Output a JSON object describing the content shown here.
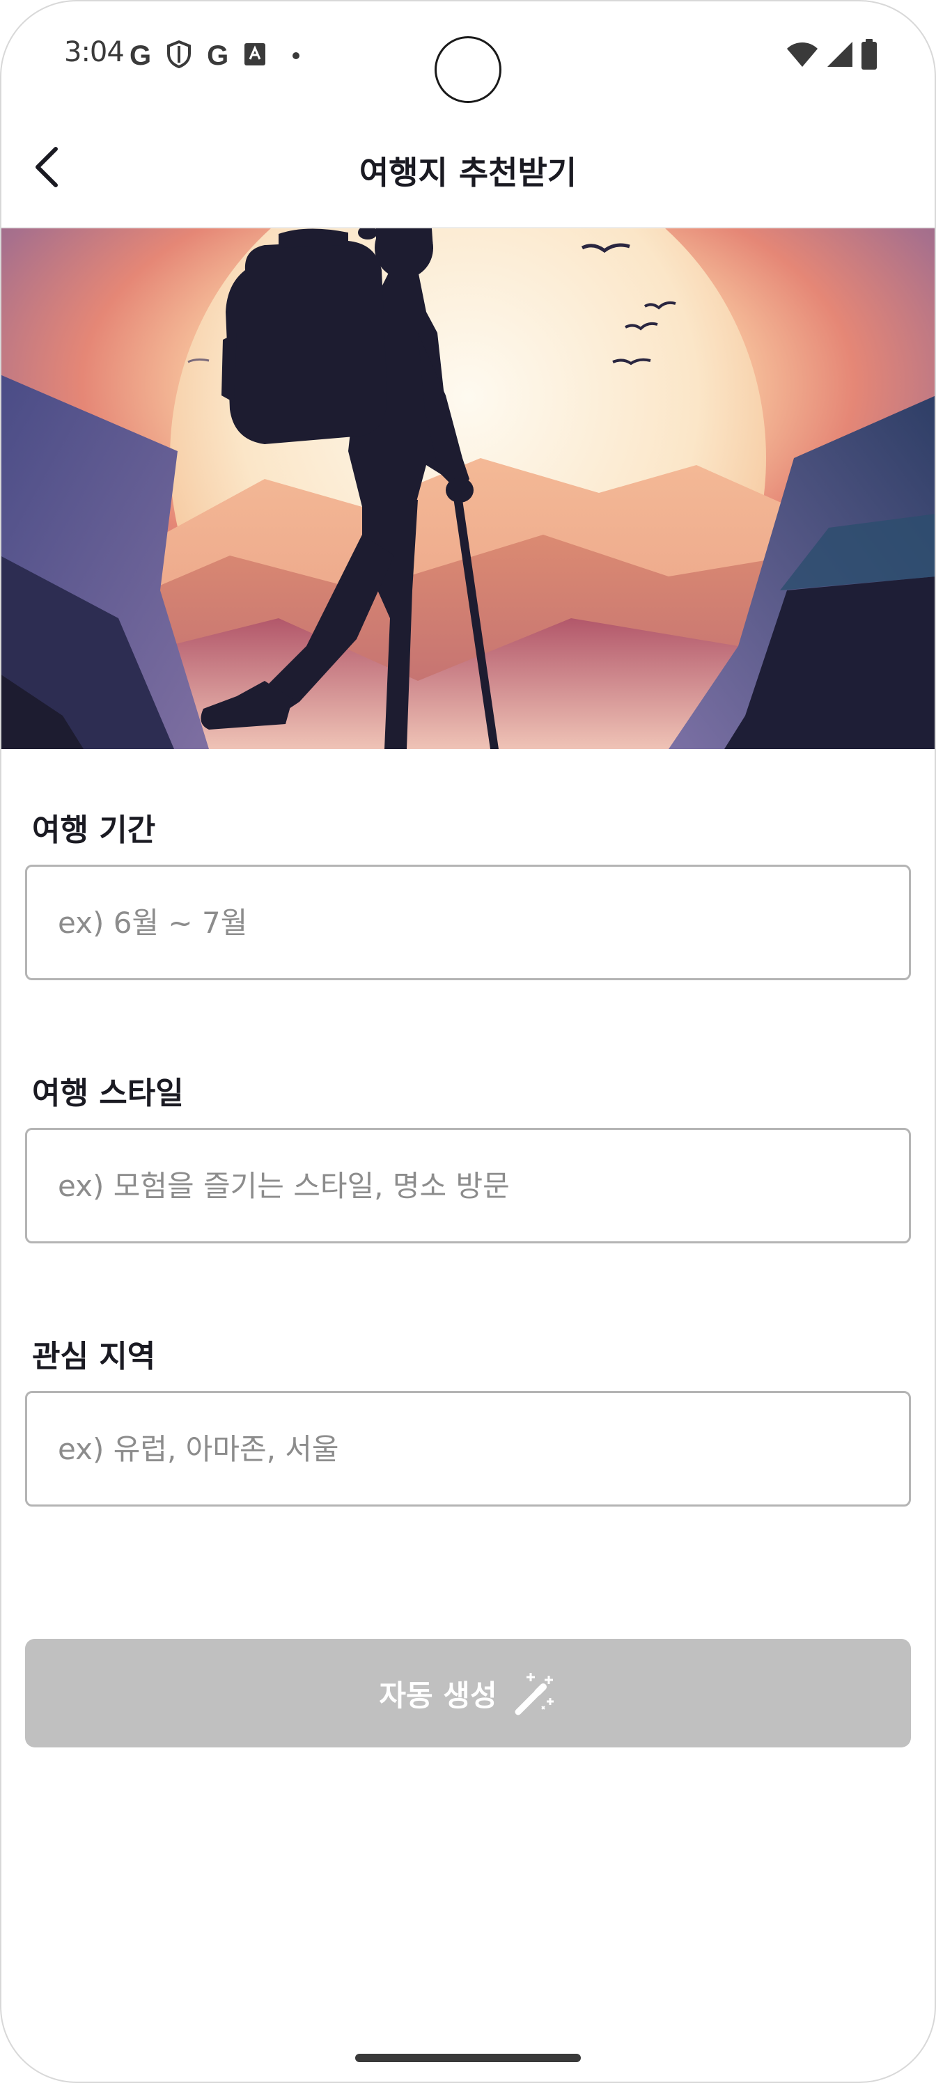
{
  "status_bar": {
    "time": "3:04",
    "left_icons": [
      "google-g-icon",
      "shield-icon",
      "google-g-icon",
      "translate-icon",
      "dot-icon"
    ],
    "right_icons": [
      "wifi-icon",
      "signal-icon",
      "battery-icon"
    ],
    "g_letter": "G"
  },
  "app_bar": {
    "title": "여행지 추천받기",
    "back_icon": "chevron-left-icon"
  },
  "hero": {
    "image": "hiker-silhouette-illustration",
    "colors": {
      "sky_top": "#8a6c94",
      "sun_glow": "#f2a17a",
      "sun": "#fdf6e4",
      "silhouette": "#1d1c30"
    }
  },
  "form": {
    "fields": [
      {
        "label": "여행 기간",
        "placeholder": "ex) 6월 ~ 7월",
        "value": ""
      },
      {
        "label": "여행 스타일",
        "placeholder": "ex) 모험을 즐기는 스타일, 명소 방문",
        "value": ""
      },
      {
        "label": "관심 지역",
        "placeholder": "ex) 유럽, 아마존, 서울",
        "value": ""
      }
    ],
    "submit": {
      "label": "자동 생성",
      "icon": "magic-wand-icon",
      "enabled": false,
      "color": "#c0c0c0"
    }
  }
}
